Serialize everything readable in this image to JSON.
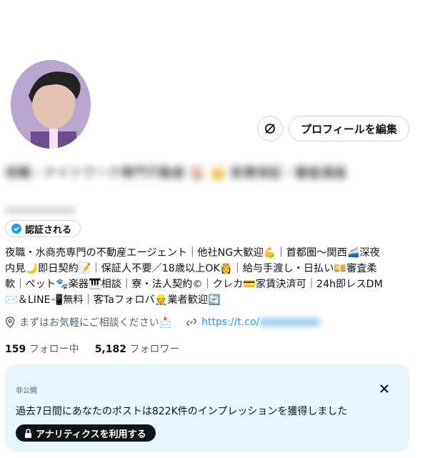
{
  "profile": {
    "avatar_icon": "avatar-photo",
    "name_blurred": "夜職・ナイトワーク専門不動産 🏠 👑 家賃保証・審査通過",
    "verified_label": "認証される",
    "bio_lines": [
      "夜職・水商売専門の不動産エージェント｜他社NG大歓迎💪｜首都圏〜関西🚄深夜",
      "内見🌙即日契約📝｜保証人不要／18歳以上OK👸｜給与手渡し・日払い💴審査柔",
      "軟｜ペット🐾楽器🎹相談｜寮・法人契約©｜クレカ💳家賃決済可｜24h即レスDM",
      "✉️＆LINE📲無料｜客Taフォロバ👷業者歓迎🔄"
    ],
    "location": "まずはお気軽にご相談ください📩",
    "url_prefix": "https://t.co/",
    "following_count": "159",
    "following_label": "フォロー中",
    "followers_count": "5,182",
    "followers_label": "フォロワー"
  },
  "actions": {
    "more_icon": "refresh-off-icon",
    "edit_profile": "プロフィールを編集"
  },
  "analytics_card": {
    "label": "非公開",
    "message": "過去7日間にあなたのポストは822K件のインプレッションを獲得しました",
    "button": "アナリティクスを利用する"
  },
  "colors": {
    "accent": "#1d9bf0",
    "card_bg": "#e8f5fd"
  }
}
